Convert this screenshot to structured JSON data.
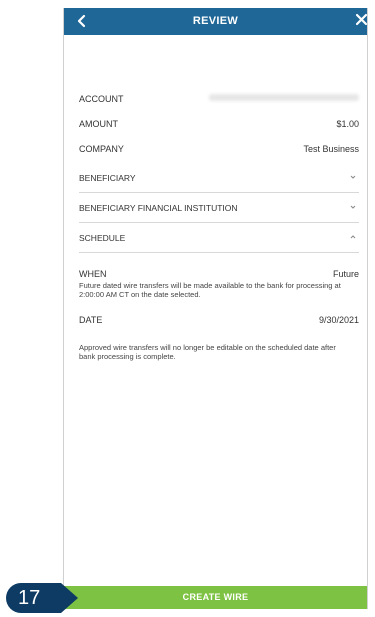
{
  "header": {
    "title": "REVIEW",
    "back_icon": "chevron-left-icon",
    "close_icon": "close-icon",
    "color": "#1f6797"
  },
  "fields": {
    "account_label": "ACCOUNT",
    "amount_label": "AMOUNT",
    "amount_value": "$1.00",
    "company_label": "COMPANY",
    "company_value": "Test Business"
  },
  "sections": {
    "beneficiary": "BENEFICIARY",
    "institution": "BENEFICIARY FINANCIAL INSTITUTION",
    "schedule": "SCHEDULE"
  },
  "schedule": {
    "when_label": "WHEN",
    "when_value": "Future",
    "when_note": "Future dated wire transfers will be made available to the bank for processing at 2:00:00 AM CT on the date selected.",
    "date_label": "DATE",
    "date_value": "9/30/2021",
    "approval_note": "Approved wire transfers will no longer be editable on the scheduled date after bank processing is complete."
  },
  "action": {
    "create_label": "CREATE WIRE",
    "color": "#7dc242"
  },
  "step": {
    "number": "17",
    "color": "#0d3b63"
  }
}
